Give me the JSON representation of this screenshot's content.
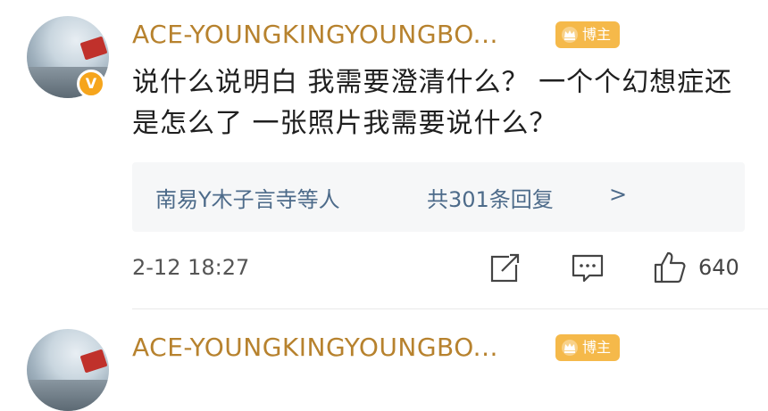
{
  "comments": [
    {
      "username": "ACE-YOUNGKINGYOUNGBO...",
      "badge": "博主",
      "text": "说什么说明白 我需要澄清什么？ 一个个幻想症还是怎么了 一张照片我需要说什么？",
      "replies": {
        "who": "南易Y木子言寺等人",
        "count": "共301条回复",
        "chevron": ">"
      },
      "time": "2-12 18:27",
      "likes": "640",
      "verified_mark": "V"
    },
    {
      "username": "ACE-YOUNGKINGYOUNGBO...",
      "badge": "博主"
    }
  ],
  "colors": {
    "username": "#b7822e",
    "badge_bg": "#f5b94a",
    "reply_link": "#4d6b8a",
    "verified_bg": "#f6a51c"
  },
  "icons": [
    "share-icon",
    "comment-icon",
    "like-icon",
    "crown-icon"
  ]
}
